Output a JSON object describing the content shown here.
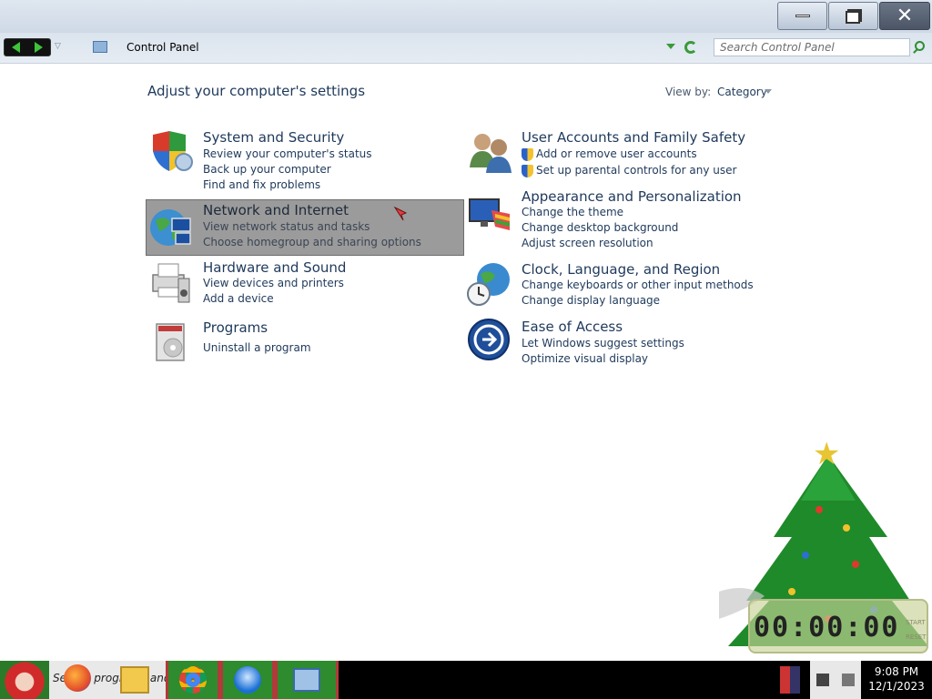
{
  "window": {
    "minimize_label": "",
    "restore_label": "",
    "close_label": ""
  },
  "addressbar": {
    "breadcrumb": "Control Panel",
    "search_placeholder": "Search Control Panel"
  },
  "main": {
    "title": "Adjust your computer's settings",
    "view_by_label": "View by:",
    "view_by_value": "Category"
  },
  "categories": [
    {
      "title": "System and Security",
      "links": [
        "Review your computer's status",
        "Back up your computer",
        "Find and fix problems"
      ]
    },
    {
      "title": "Network and Internet",
      "links": [
        "View network status and tasks",
        "Choose homegroup and sharing options"
      ]
    },
    {
      "title": "Hardware and Sound",
      "links": [
        "View devices and printers",
        "Add a device"
      ]
    },
    {
      "title": "Programs",
      "links": [
        "Uninstall a program"
      ]
    },
    {
      "title": "User Accounts and Family Safety",
      "links": [
        "Add or remove user accounts",
        "Set up parental controls for any user"
      ]
    },
    {
      "title": "Appearance and Personalization",
      "links": [
        "Change the theme",
        "Change desktop background",
        "Adjust screen resolution"
      ]
    },
    {
      "title": "Clock, Language, and Region",
      "links": [
        "Change keyboards or other input methods",
        "Change display language"
      ]
    },
    {
      "title": "Ease of Access",
      "links": [
        "Let Windows suggest settings",
        "Optimize visual display"
      ]
    }
  ],
  "widget": {
    "digits": "00:00:00",
    "start_label": "START",
    "reset_label": "RESET"
  },
  "taskbar": {
    "search_text": "Search programs and files",
    "apps": [
      "firefox-icon",
      "file-explorer-icon",
      "chrome-icon",
      "thunderbird-icon",
      "control-panel-icon"
    ],
    "time": "9:08 PM",
    "date": "12/1/2023"
  }
}
